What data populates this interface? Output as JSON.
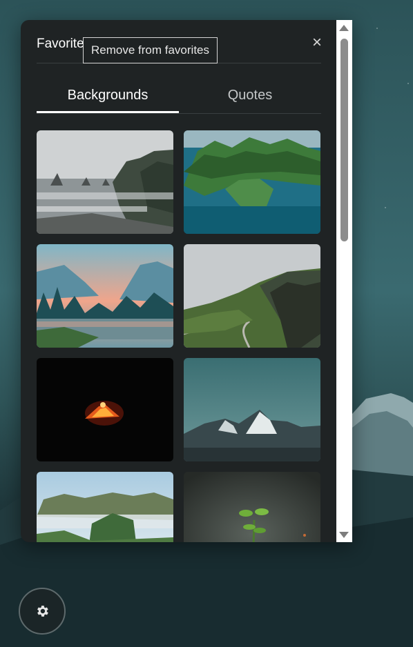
{
  "panel": {
    "title": "Favorites",
    "close_glyph": "×"
  },
  "tooltip": {
    "text": "Remove from favorites"
  },
  "tabs": [
    {
      "label": "Backgrounds",
      "active": true
    },
    {
      "label": "Quotes",
      "active": false
    }
  ],
  "favorites": [
    {
      "name": "rocky-sea-coast"
    },
    {
      "name": "green-coastal-cliffs"
    },
    {
      "name": "misty-valley-lake"
    },
    {
      "name": "green-highland-road"
    },
    {
      "name": "erupting-volcano-night"
    },
    {
      "name": "snowy-peak-teal-sky"
    },
    {
      "name": "misty-green-hills"
    },
    {
      "name": "seedling-sprout"
    }
  ],
  "icons": {
    "close": "close-icon",
    "settings": "gear-icon",
    "scroll_up": "scroll-up-arrow-icon",
    "scroll_down": "scroll-down-arrow-icon"
  },
  "colors": {
    "panel_bg": "#1f2324",
    "accent_white": "#ffffff",
    "inactive_tab": "#c4c7c8"
  }
}
